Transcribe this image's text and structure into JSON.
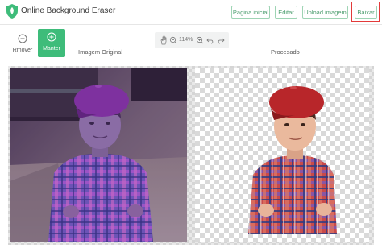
{
  "app": {
    "title": "Online Background Eraser",
    "logo_icon": "shield-leaf-icon",
    "brand_color": "#3ebc7a"
  },
  "nav": {
    "home_label": "Pagina inicial",
    "edit_label": "Editar",
    "upload_label": "Upload imagem",
    "download_label": "Baixar"
  },
  "tools": {
    "remove_label": "Rmover",
    "keep_label": "Manter",
    "remove_icon": "minus-circle-icon",
    "keep_icon": "plus-circle-icon"
  },
  "zoom": {
    "level": "114%"
  },
  "panels": {
    "original_label": "Imagem Original",
    "processed_label": "Procesado"
  },
  "colors": {
    "highlight": "#e33a3a",
    "accent": "#3ebc7a"
  }
}
